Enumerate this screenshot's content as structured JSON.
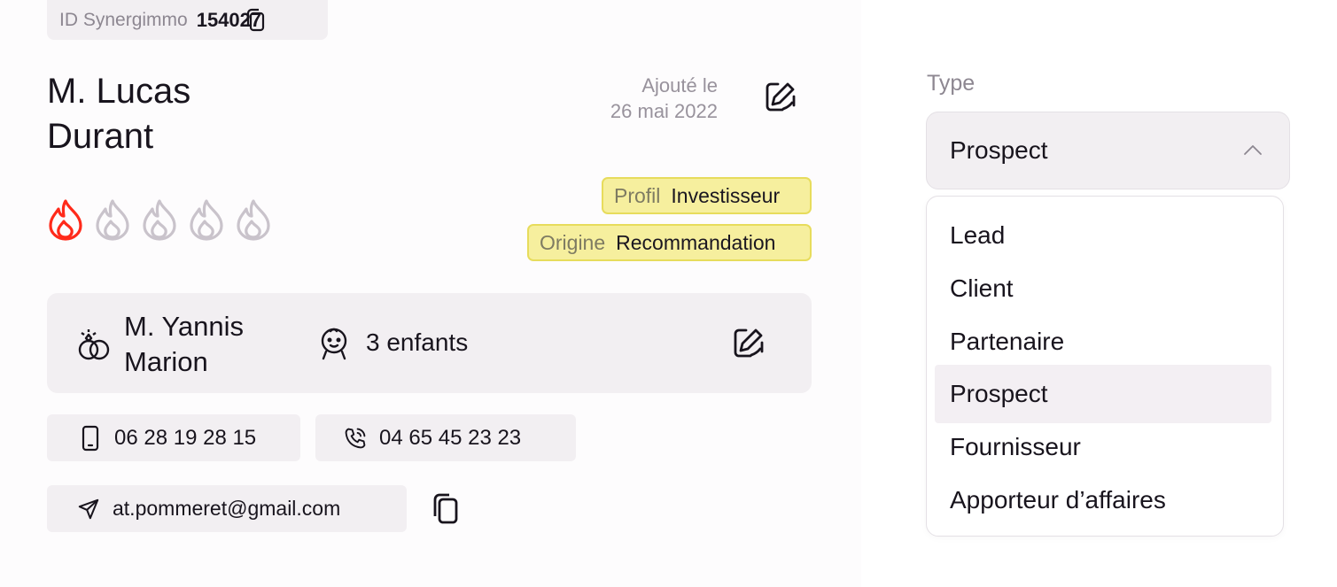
{
  "header": {
    "id_label": "ID Synergimmo",
    "id_value": "154027"
  },
  "contact": {
    "name_line1": "M. Lucas",
    "name_line2": "Durant",
    "added_label": "Ajouté le",
    "added_date": "26 mai 2022",
    "rating": {
      "value": 1,
      "max": 5,
      "active_color": "#ff2a1a",
      "inactive_color": "#c9c3cb"
    },
    "tags": {
      "profil_key": "Profil",
      "profil_value": "Investisseur",
      "origine_key": "Origine",
      "origine_value": "Recommandation"
    },
    "family": {
      "spouse_line1": "M. Yannis",
      "spouse_line2": "Marion",
      "children": "3 enfants"
    },
    "mobile": "06 28 19 28 15",
    "landline": "04 65 45 23 23",
    "email": "at.pommeret@gmail.com"
  },
  "type_select": {
    "label": "Type",
    "value": "Prospect",
    "options": [
      "Lead",
      "Client",
      "Partenaire",
      "Prospect",
      "Fournisseur",
      "Apporteur d’affaires"
    ]
  },
  "colors": {
    "tag_bg": "#f6ef9e",
    "tag_border": "#e7dc5c",
    "chip_bg": "#f2eff2"
  }
}
